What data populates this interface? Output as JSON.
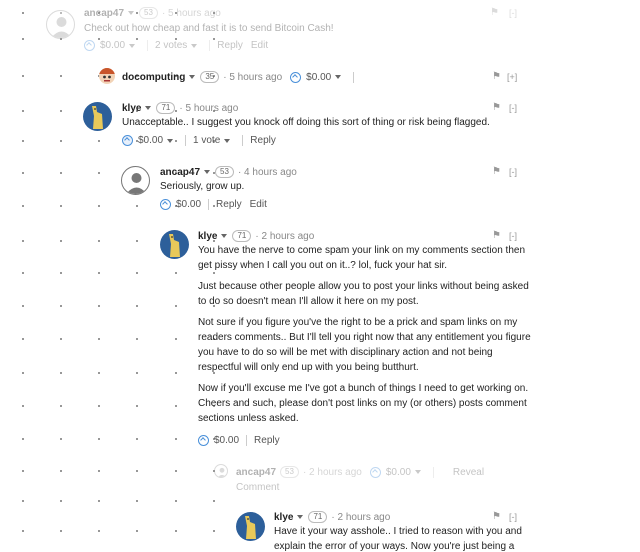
{
  "comments": [
    {
      "author": "ancap47",
      "rep": "53",
      "time": "· 5 hours ago",
      "text": "Check out how cheap and fast it is to send Bitcoin Cash!",
      "amount": "$0.00",
      "votes": "2 votes",
      "reply": "Reply",
      "edit": "Edit",
      "collapse": "[-]",
      "faded": true
    },
    {
      "author": "docomputing",
      "rep": "35",
      "time": "· 5 hours ago",
      "amount": "$0.00",
      "collapse": "[+]"
    },
    {
      "author": "klye",
      "rep": "71",
      "time": "· 5 hours ago",
      "text": "Unacceptable.. I suggest you knock off doing this sort of thing or risk being flagged.",
      "amount": "$0.00",
      "votes": "1 vote",
      "reply": "Reply",
      "collapse": "[-]"
    },
    {
      "author": "ancap47",
      "rep": "53",
      "time": "· 4 hours ago",
      "text": "Seriously, grow up.",
      "amount": "$0.00",
      "reply": "Reply",
      "edit": "Edit",
      "collapse": "[-]"
    },
    {
      "author": "klye",
      "rep": "71",
      "time": "· 2 hours ago",
      "paragraphs": [
        "You have the nerve to come spam your link on my comments section then get pissy when I call you out on it..? lol, fuck your hat sir.",
        "Just because other people allow you to post your links without being asked to do so doesn't mean I'll allow it here on my post.",
        "Not sure if you figure you've the right to be a prick and spam links on my readers comments.. But I'll tell you right now that any entitlement you figure you have to do so will be met with disciplinary action and not being respectful will only end up with you being butthurt.",
        "Now if you'll excuse me I've got a bunch of things I need to get working on. Cheers and such, please don't post links on my (or others) posts comment sections unless asked."
      ],
      "amount": "$0.00",
      "reply": "Reply",
      "collapse": "[-]"
    },
    {
      "author": "ancap47",
      "rep": "53",
      "time": "· 2 hours ago",
      "amount": "$0.00",
      "reveal": "Reveal",
      "comment": "Comment",
      "faded": true
    },
    {
      "author": "klye",
      "rep": "71",
      "time": "· 2 hours ago",
      "text": "Have it your way asshole.. I tried to reason with you and explain the error of your ways. Now you're just being a",
      "collapse": "[-]"
    }
  ],
  "colors": {
    "upvote": "#4a90d9",
    "klye_avatar_bg": "#2d5f9a",
    "klye_avatar_fg": "#e8c95a"
  }
}
